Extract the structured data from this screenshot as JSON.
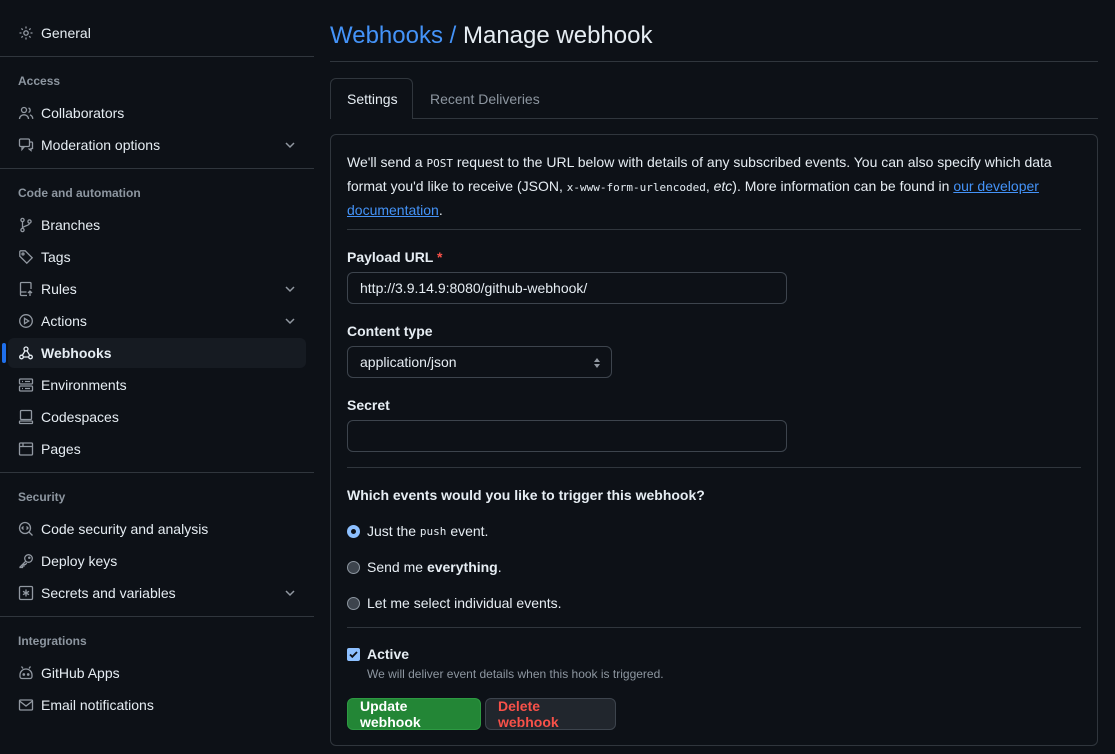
{
  "sidebar": {
    "general": "General",
    "sections": {
      "access": "Access",
      "code_automation": "Code and automation",
      "security": "Security",
      "integrations": "Integrations"
    },
    "items": {
      "collaborators": "Collaborators",
      "moderation": "Moderation options",
      "branches": "Branches",
      "tags": "Tags",
      "rules": "Rules",
      "actions": "Actions",
      "webhooks": "Webhooks",
      "environments": "Environments",
      "codespaces": "Codespaces",
      "pages": "Pages",
      "code_security": "Code security and analysis",
      "deploy_keys": "Deploy keys",
      "secrets": "Secrets and variables",
      "github_apps": "GitHub Apps",
      "email_notifications": "Email notifications"
    },
    "active_item": "Webhooks"
  },
  "header": {
    "breadcrumb_link": "Webhooks",
    "separator": "/",
    "current": "Manage webhook"
  },
  "tabs": {
    "settings": "Settings",
    "recent_deliveries": "Recent Deliveries"
  },
  "intro": {
    "part1": "We'll send a ",
    "post": "POST",
    "part2": " request to the URL below with details of any subscribed events. You can also specify which data format you'd like to receive (JSON, ",
    "form_encoded": "x-www-form-urlencoded",
    "part3": ", ",
    "etc": "etc",
    "part4": "). More information can be found in ",
    "link": "our developer documentation",
    "part5": "."
  },
  "form": {
    "payload_url_label": "Payload URL",
    "required_marker": "*",
    "payload_url_value": "http://3.9.14.9:8080/github-webhook/",
    "content_type_label": "Content type",
    "content_type_value": "application/json",
    "secret_label": "Secret",
    "secret_value": "",
    "events_question": "Which events would you like to trigger this webhook?",
    "radio_push_pre": "Just the ",
    "radio_push_code": "push",
    "radio_push_post": " event.",
    "radio_everything_pre": "Send me ",
    "radio_everything_bold": "everything",
    "radio_everything_post": ".",
    "radio_individual": "Let me select individual events.",
    "active_label": "Active",
    "active_note": "We will deliver event details when this hook is triggered.",
    "update_button": "Update webhook",
    "delete_button": "Delete webhook"
  },
  "colors": {
    "background": "#0d1117",
    "accent_link": "#4493f8",
    "primary_button": "#238636",
    "danger_text": "#f85149",
    "active_indicator": "#1f6feb"
  }
}
